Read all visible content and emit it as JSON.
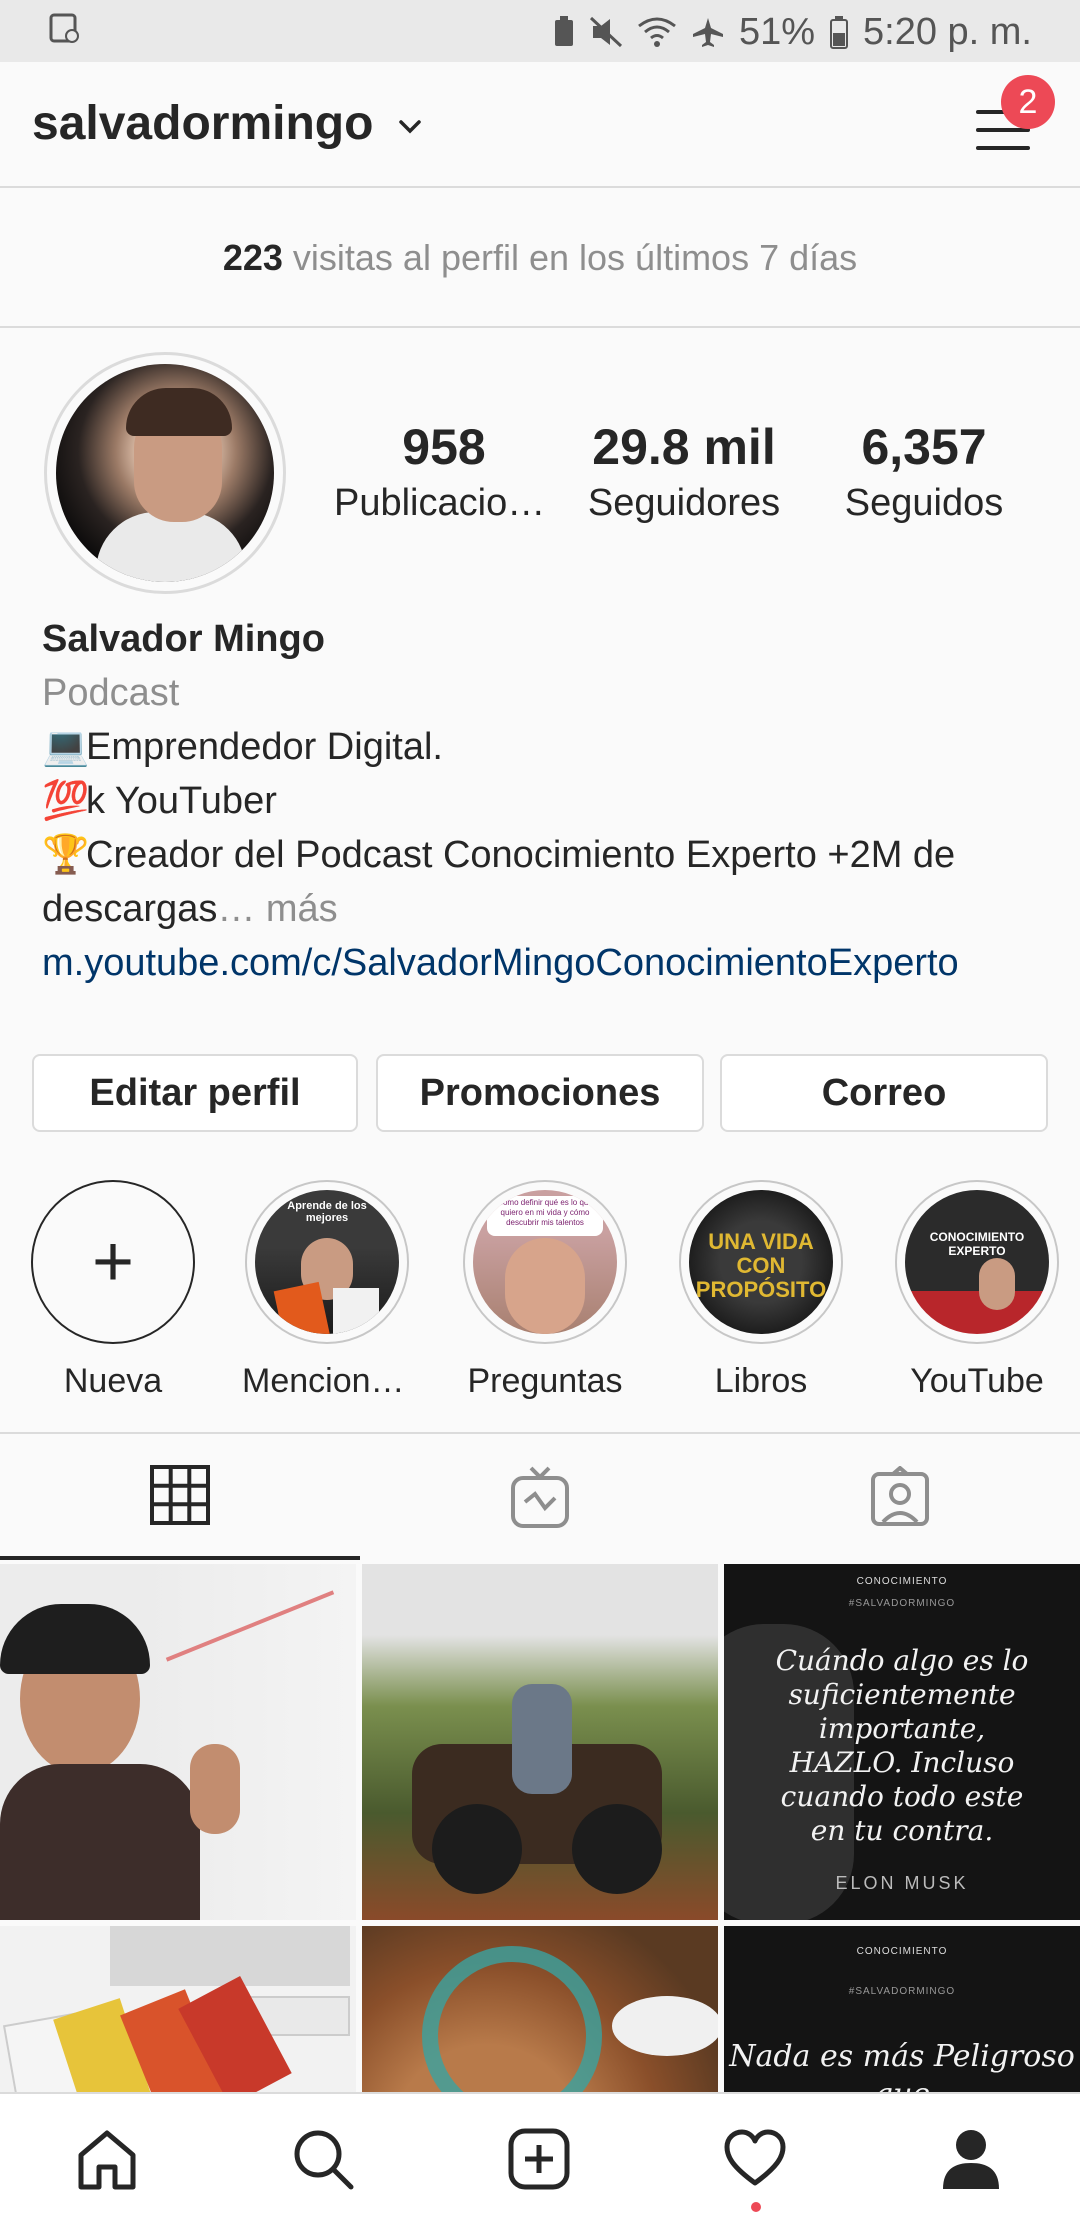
{
  "status_bar": {
    "battery": "51%",
    "time": "5:20 p. m."
  },
  "header": {
    "username": "salvadormingo",
    "notification_count": "2"
  },
  "visits": {
    "count": "223",
    "text": "visitas al perfil en los últimos 7 días"
  },
  "stats": {
    "posts": {
      "value": "958",
      "label": "Publicaciones"
    },
    "followers": {
      "value": "29.8 mil",
      "label": "Seguidores"
    },
    "following": {
      "value": "6,357",
      "label": "Seguidos"
    }
  },
  "bio": {
    "name": "Salvador Mingo",
    "category": "Podcast",
    "line1_emoji": "💻",
    "line1": "Emprendedor Digital.",
    "line2_emoji": "💯",
    "line2": "k YouTuber",
    "line3_emoji": "🏆",
    "line3": "Creador del Podcast Conocimiento Experto +2M de descargas",
    "ellipsis": "…",
    "more": "más",
    "link": "m.youtube.com/c/SalvadorMingoConocimientoExperto"
  },
  "buttons": {
    "edit": "Editar perfil",
    "promotions": "Promociones",
    "email": "Correo"
  },
  "highlights": [
    {
      "label": "Nueva"
    },
    {
      "label": "Menciones ...",
      "overlay": "Aprende de los mejores"
    },
    {
      "label": "Preguntas",
      "overlay": "Cómo definir qué es lo que quiero en mi vida y cómo descubrir mis talentos"
    },
    {
      "label": "Libros",
      "overlay": "UNA VIDA CON PROPÓSITO"
    },
    {
      "label": "YouTube",
      "overlay": "CONOCIMIENTO EXPERTO"
    }
  ],
  "posts": {
    "quote1": "Cuándo algo es lo suficientemente importante, HAZLO. Incluso cuando todo este en tu contra.",
    "quote1_author": "ELON MUSK",
    "quote2": "Nada es más Peligroso que",
    "brand": "CONOCIMIENTO",
    "brand2": "#SALVADORMINGO"
  },
  "colors": {
    "accent_red": "#ed4956",
    "link": "#003569",
    "text": "#262626",
    "muted": "#8e8e8e"
  },
  "icons": {
    "tab_grid": "grid-icon",
    "tab_igtv": "igtv-icon",
    "tab_tagged": "tagged-icon",
    "nav_home": "home-icon",
    "nav_search": "search-icon",
    "nav_add": "add-post-icon",
    "nav_activity": "heart-icon",
    "nav_profile": "profile-icon"
  }
}
